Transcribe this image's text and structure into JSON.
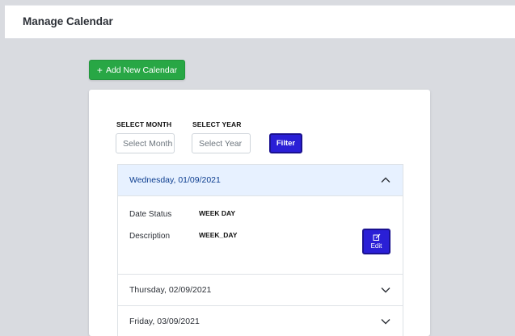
{
  "header": {
    "title": "Manage Calendar"
  },
  "toolbar": {
    "add_label": "Add New Calendar",
    "add_icon": "plus-icon"
  },
  "filters": {
    "month_label": "SELECT MONTH",
    "month_placeholder": "Select Month",
    "year_label": "SELECT YEAR",
    "year_placeholder": "Select Year",
    "filter_label": "Filter"
  },
  "calendar": {
    "entries": [
      {
        "date": "Wednesday, 01/09/2021",
        "expanded": true,
        "status_label": "Date Status",
        "status_value": "WEEK DAY",
        "description_label": "Description",
        "description_value": "WEEK_DAY",
        "edit_label": "Edit"
      },
      {
        "date": "Thursday, 02/09/2021",
        "expanded": false
      },
      {
        "date": "Friday, 03/09/2021",
        "expanded": false
      }
    ]
  },
  "colors": {
    "add_button": "#28a745",
    "primary_button": "#2a1fd6",
    "expanded_header_bg": "#e7f1ff",
    "expanded_header_text": "#0c3d8f"
  }
}
